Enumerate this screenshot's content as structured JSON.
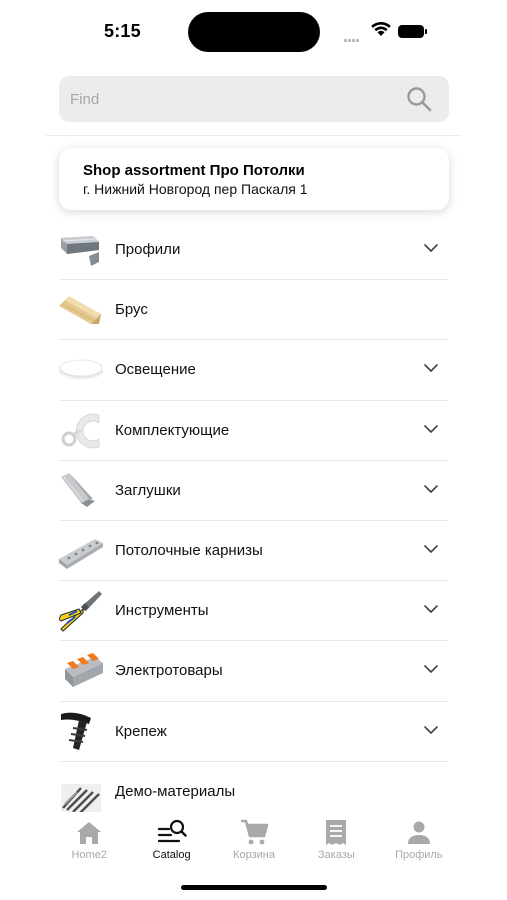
{
  "status_bar": {
    "time": "5:15"
  },
  "search": {
    "placeholder": "Find"
  },
  "shop": {
    "title": "Shop assortment Про Потолки",
    "address": "г. Нижний Новгород пер Паскаля 1"
  },
  "categories": [
    {
      "label": "Профили",
      "icon": "profile-rail-image",
      "expandable": true
    },
    {
      "label": "Брус",
      "icon": "wooden-beam-image",
      "expandable": false
    },
    {
      "label": "Освещение",
      "icon": "ceiling-lamp-image",
      "expandable": true
    },
    {
      "label": "Комплектующие",
      "icon": "ring-parts-image",
      "expandable": true
    },
    {
      "label": "Заглушки",
      "icon": "plug-image",
      "expandable": true
    },
    {
      "label": "Потолочные карнизы",
      "icon": "cornice-image",
      "expandable": true
    },
    {
      "label": "Инструменты",
      "icon": "pliers-image",
      "expandable": true
    },
    {
      "label": "Электротовары",
      "icon": "connector-image",
      "expandable": true
    },
    {
      "label": "Крепеж",
      "icon": "dowel-image",
      "expandable": true
    },
    {
      "label": "Демо-материалы",
      "icon": "samples-image",
      "expandable": false
    }
  ],
  "tabs": [
    {
      "label": "Home2",
      "icon": "home-icon",
      "active": false
    },
    {
      "label": "Catalog",
      "icon": "catalog-search-icon",
      "active": true
    },
    {
      "label": "Корзина",
      "icon": "cart-icon",
      "active": false
    },
    {
      "label": "Заказы",
      "icon": "receipt-icon",
      "active": false
    },
    {
      "label": "Профиль",
      "icon": "person-icon",
      "active": false
    }
  ],
  "colors": {
    "accent": "#111111",
    "inactive_tab": "#a9a9a9",
    "search_bg": "#ececec"
  }
}
